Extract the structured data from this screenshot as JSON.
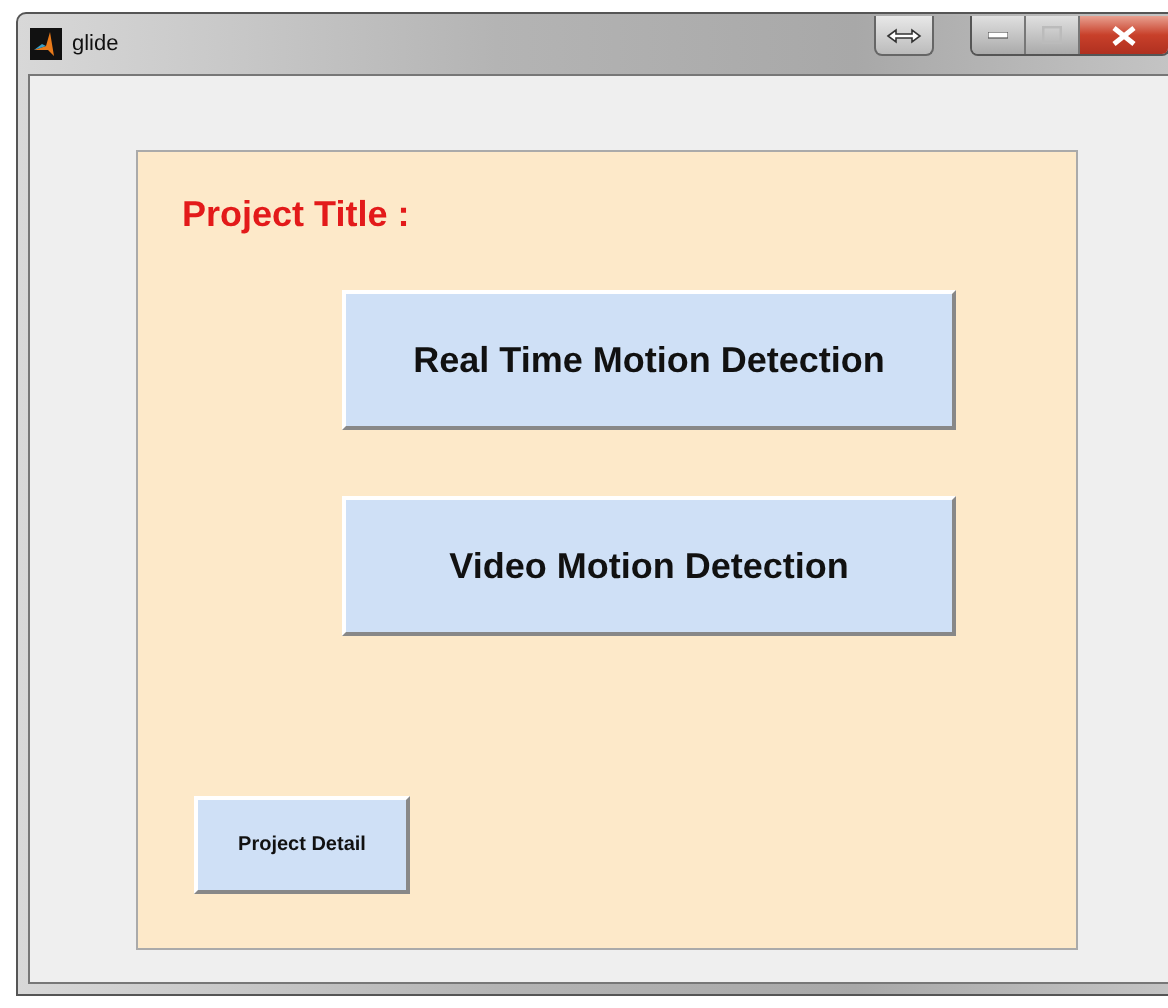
{
  "window": {
    "title": "glide"
  },
  "panel": {
    "title": "Project Title :"
  },
  "buttons": [
    {
      "label": "Real Time Motion Detection",
      "kind": "large"
    },
    {
      "label": "Video Motion Detection",
      "kind": "large"
    },
    {
      "label": "Project Detail",
      "kind": "small"
    }
  ]
}
